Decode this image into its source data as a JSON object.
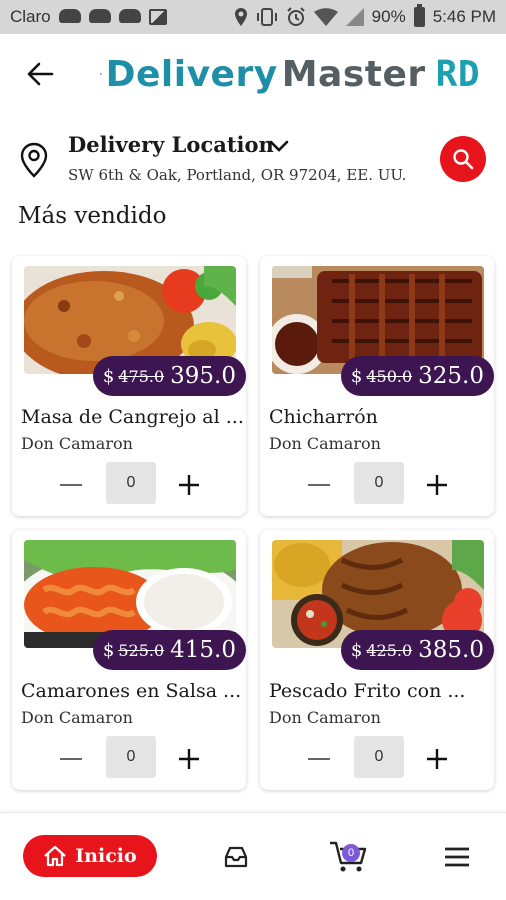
{
  "status_bar": {
    "carrier": "Claro",
    "battery": "90%",
    "time": "5:46 PM",
    "icons": [
      "cloud-icon",
      "cloud-icon",
      "cloud-icon",
      "image-icon",
      "location-icon",
      "vibrate-icon",
      "alarm-icon",
      "wifi-icon",
      "signal-icon",
      "battery-icon"
    ]
  },
  "header": {
    "logo_delivery": "Delivery",
    "logo_master": "Master",
    "logo_rd": "RD",
    "back_icon": "arrow-left-icon"
  },
  "location": {
    "title": "Delivery Location",
    "address": "SW 6th & Oak, Portland, OR 97204, EE. UU."
  },
  "section_title": "Más vendido",
  "products": [
    {
      "name": "Masa de Cangrejo al ...",
      "store": "Don Camaron",
      "currency": "$",
      "old_price": "475.0",
      "price": "395.0",
      "quantity": "0"
    },
    {
      "name": "Chicharrón",
      "store": "Don Camaron",
      "currency": "$",
      "old_price": "450.0",
      "price": "325.0",
      "quantity": "0"
    },
    {
      "name": "Camarones en Salsa ...",
      "store": "Don Camaron",
      "currency": "$",
      "old_price": "525.0",
      "price": "415.0",
      "quantity": "0"
    },
    {
      "name": "Pescado Frito con ...",
      "store": "Don Camaron",
      "currency": "$",
      "old_price": "425.0",
      "price": "385.0",
      "quantity": "0"
    }
  ],
  "bottom_nav": {
    "home_label": "Inicio",
    "cart_count": "0"
  },
  "colors": {
    "accent_red": "#e8141c",
    "price_pill": "#3d1550",
    "logo_teal": "#1f8fa8",
    "logo_gray": "#555e63",
    "cart_badge": "#7c5ad6"
  }
}
